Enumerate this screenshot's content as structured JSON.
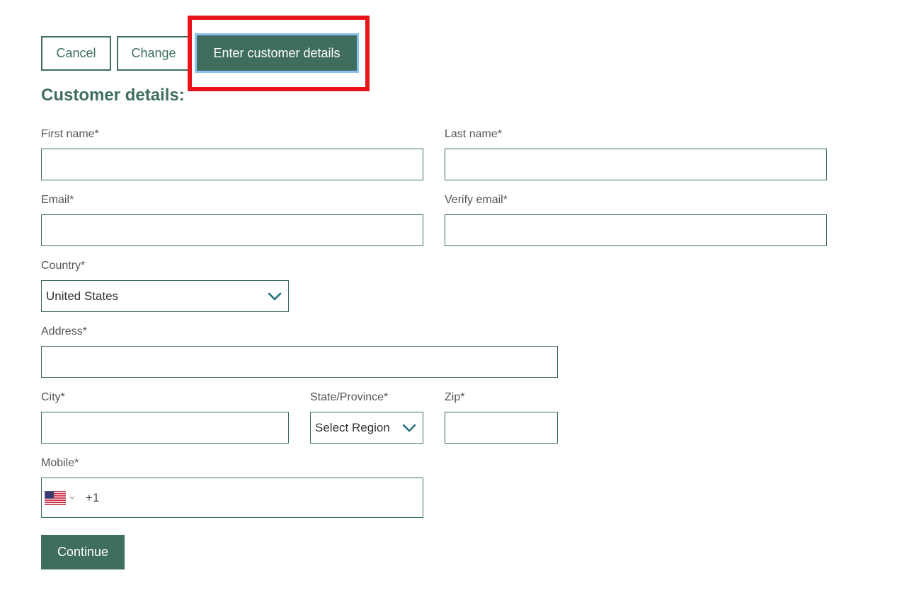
{
  "buttons": {
    "cancel": "Cancel",
    "change": "Change",
    "enter_details": "Enter customer details",
    "continue": "Continue"
  },
  "title": "Customer details:",
  "fields": {
    "first_name": {
      "label": "First name*",
      "value": ""
    },
    "last_name": {
      "label": "Last name*",
      "value": ""
    },
    "email": {
      "label": "Email*",
      "value": ""
    },
    "verify_email": {
      "label": "Verify email*",
      "value": ""
    },
    "country": {
      "label": "Country*",
      "value": "United States"
    },
    "address": {
      "label": "Address*",
      "value": ""
    },
    "city": {
      "label": "City*",
      "value": ""
    },
    "state": {
      "label": "State/Province*",
      "value": "Select Region"
    },
    "zip": {
      "label": "Zip*",
      "value": ""
    },
    "mobile": {
      "label": "Mobile*",
      "dial_code": "+1",
      "flag": "us-flag-icon"
    }
  },
  "colors": {
    "brand_green": "#3f6e5f",
    "highlight_red": "#e8141a",
    "focus_blue": "#8ec2ee",
    "chevron_teal": "#1f6f7a"
  }
}
